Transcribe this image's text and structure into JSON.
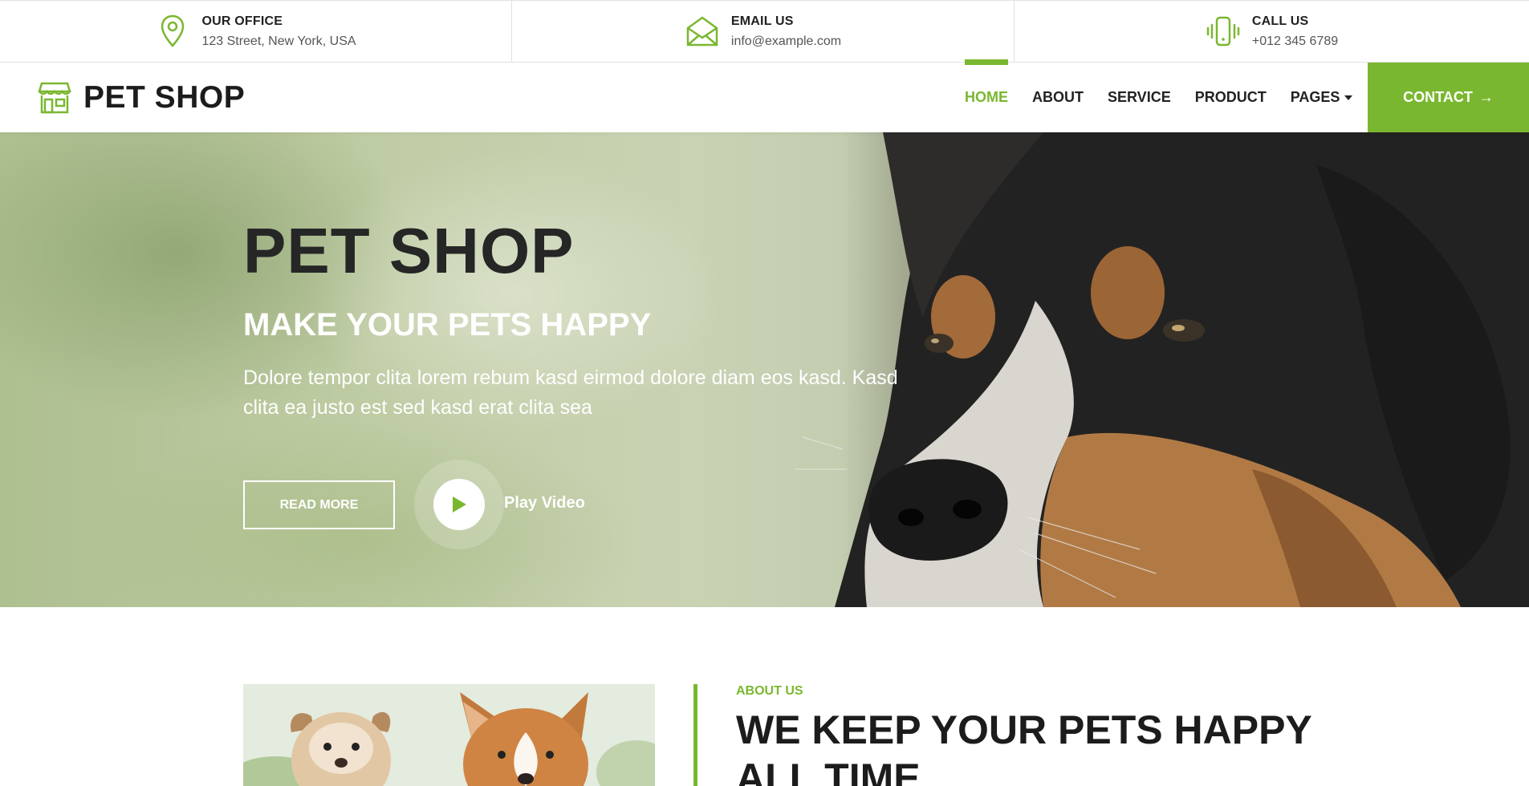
{
  "topbar": {
    "office": {
      "icon": "map-pin-icon",
      "title": "OUR OFFICE",
      "value": "123 Street, New York, USA"
    },
    "email": {
      "icon": "envelope-icon",
      "title": "EMAIL US",
      "value": "info@example.com"
    },
    "phone": {
      "icon": "phone-vibrate-icon",
      "title": "CALL US",
      "value": "+012 345 6789"
    }
  },
  "brand": {
    "icon": "shop-icon",
    "name": "PET SHOP"
  },
  "nav": {
    "items": [
      {
        "label": "HOME",
        "active": true
      },
      {
        "label": "ABOUT"
      },
      {
        "label": "SERVICE"
      },
      {
        "label": "PRODUCT"
      },
      {
        "label": "PAGES",
        "dropdown": true
      }
    ],
    "contact_label": "CONTACT",
    "contact_arrow": "→"
  },
  "hero": {
    "title": "PET SHOP",
    "subtitle": "MAKE YOUR PETS HAPPY",
    "text": "Dolore tempor clita lorem rebum kasd eirmod dolore diam eos kasd. Kasd clita ea justo est sed kasd erat clita sea",
    "read_more": "READ MORE",
    "play_label": "Play Video"
  },
  "about": {
    "kicker": "ABOUT US",
    "title": "WE KEEP YOUR PETS HAPPY ALL TIME"
  },
  "colors": {
    "accent": "#7ab730",
    "dark": "#1c1c1c"
  }
}
